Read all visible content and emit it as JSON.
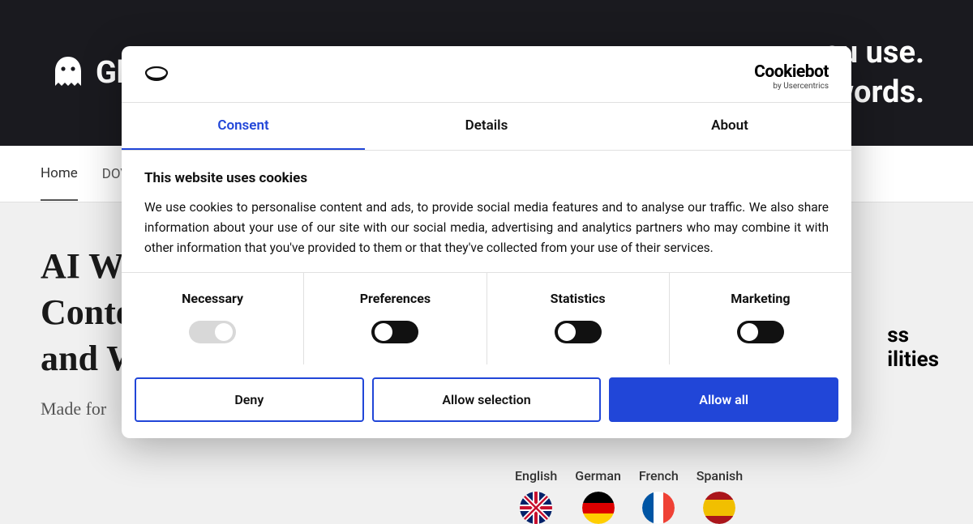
{
  "header": {
    "logo_text": "Gh",
    "tagline_line1": "ou use.",
    "tagline_line2": "words."
  },
  "nav": {
    "items": [
      "Home",
      "DOV"
    ]
  },
  "hero": {
    "title": "AI Wr\nConte\nand W",
    "subtitle": "Made for"
  },
  "right_partial": {
    "line1": "ss",
    "line2": "ilities"
  },
  "languages": {
    "items": [
      "English",
      "German",
      "French",
      "Spanish"
    ]
  },
  "cookie_modal": {
    "brand": "Cookiebot",
    "brand_sub": "by Usercentrics",
    "tabs": [
      "Consent",
      "Details",
      "About"
    ],
    "heading": "This website uses cookies",
    "body": "We use cookies to personalise content and ads, to provide social media features and to analyse our traffic. We also share information about your use of our site with our social media, advertising and analytics partners who may combine it with other information that you've provided to them or that they've collected from your use of their services.",
    "categories": [
      "Necessary",
      "Preferences",
      "Statistics",
      "Marketing"
    ],
    "buttons": {
      "deny": "Deny",
      "allow_selection": "Allow selection",
      "allow_all": "Allow all"
    }
  }
}
